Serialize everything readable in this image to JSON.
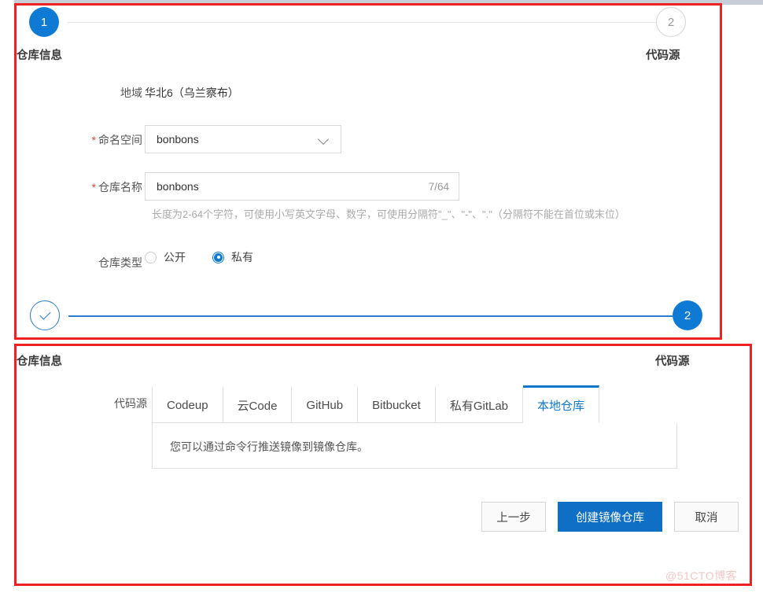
{
  "stepper_top": {
    "step1_number": "1",
    "step1_label": "仓库信息",
    "step2_number": "2",
    "step2_label": "代码源"
  },
  "form": {
    "region_label": "地域",
    "region_value": "华北6（乌兰察布）",
    "namespace_label": "命名空间",
    "namespace_value": "bonbons",
    "namespace_required": "*",
    "repo_name_label": "仓库名称",
    "repo_name_value": "bonbons",
    "repo_name_required": "*",
    "repo_name_counter": "7/64",
    "repo_name_help": "长度为2-64个字符，可使用小写英文字母、数字，可使用分隔符\"_\"、\"-\"、\".\"（分隔符不能在首位或末位）",
    "repo_type_label": "仓库类型",
    "repo_type_options": [
      {
        "label": "公开",
        "selected": false
      },
      {
        "label": "私有",
        "selected": true
      }
    ]
  },
  "stepper_bottom": {
    "step1_icon": "check-icon",
    "step1_label": "仓库信息",
    "step2_number": "2",
    "step2_label": "代码源"
  },
  "source": {
    "label": "代码源",
    "tabs": [
      {
        "label": "Codeup",
        "active": false
      },
      {
        "label": "云Code",
        "active": false
      },
      {
        "label": "GitHub",
        "active": false
      },
      {
        "label": "Bitbucket",
        "active": false
      },
      {
        "label": "私有GitLab",
        "active": false
      },
      {
        "label": "本地仓库",
        "active": true
      }
    ],
    "body_text": "您可以通过命令行推送镜像到镜像仓库。"
  },
  "actions": {
    "prev_label": "上一步",
    "create_label": "创建镜像仓库",
    "cancel_label": "取消"
  },
  "watermark": "@51CTO博客",
  "colors": {
    "accent_blue": "#0f7ad3",
    "primary_button": "#0f6fc5",
    "tab_active": "#1177cc",
    "required_red": "#e8403a",
    "annotation_red": "#ee2222"
  }
}
